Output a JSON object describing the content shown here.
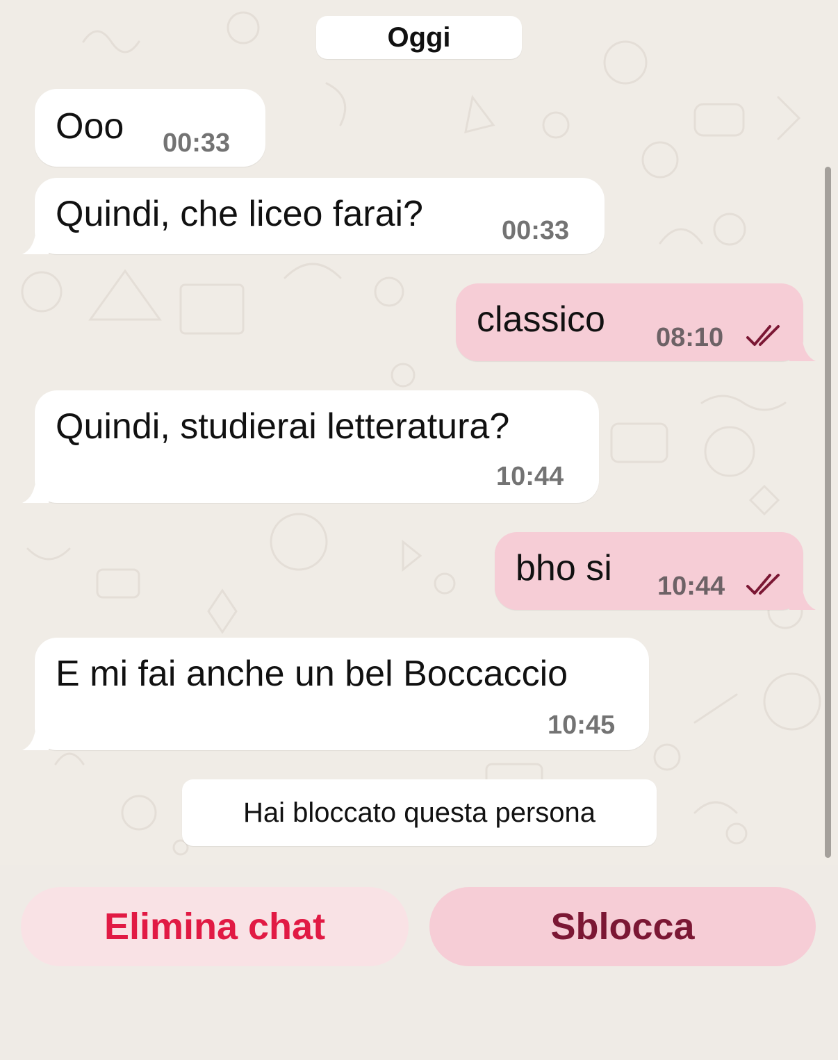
{
  "date_separator": "Oggi",
  "messages": [
    {
      "direction": "incoming",
      "text": "Ooo",
      "time": "00:33"
    },
    {
      "direction": "incoming",
      "text": "Quindi, che liceo farai?",
      "time": "00:33"
    },
    {
      "direction": "outgoing",
      "text": "classico",
      "time": "08:10",
      "status": "read"
    },
    {
      "direction": "incoming",
      "text": "Quindi, studierai letteratura?",
      "time": "10:44"
    },
    {
      "direction": "outgoing",
      "text": "bho si",
      "time": "10:44",
      "status": "read"
    },
    {
      "direction": "incoming",
      "text": "E mi fai anche un bel Boccaccio",
      "time": "10:45"
    }
  ],
  "system_notice": "Hai bloccato questa persona",
  "actions": {
    "delete_label": "Elimina chat",
    "unblock_label": "Sblocca"
  },
  "icons": {
    "read_receipt": "double-check-icon"
  },
  "colors": {
    "outgoing_bubble": "#f6cdd6",
    "incoming_bubble": "#ffffff",
    "delete_text": "#e11a44",
    "unblock_text": "#7b1734",
    "read_ticks": "#7b1734"
  }
}
